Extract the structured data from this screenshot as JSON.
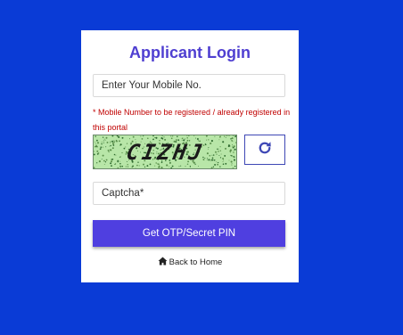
{
  "login": {
    "title": "Applicant Login",
    "mobile_placeholder": "Enter Your Mobile No.",
    "note": "* Mobile Number to be registered / already registered in this portal",
    "captcha_text": "CIZHJ",
    "captcha_placeholder": "Captcha*",
    "submit_label": "Get OTP/Secret PIN",
    "back_label": "Back to Home"
  },
  "icons": {
    "refresh": "refresh-icon",
    "home": "home-icon"
  },
  "colors": {
    "background": "#0a3bd6",
    "title": "#4f3fd1",
    "button": "#4f3fe0",
    "note": "#c00000",
    "captcha_bg": "#b8e6a8"
  }
}
